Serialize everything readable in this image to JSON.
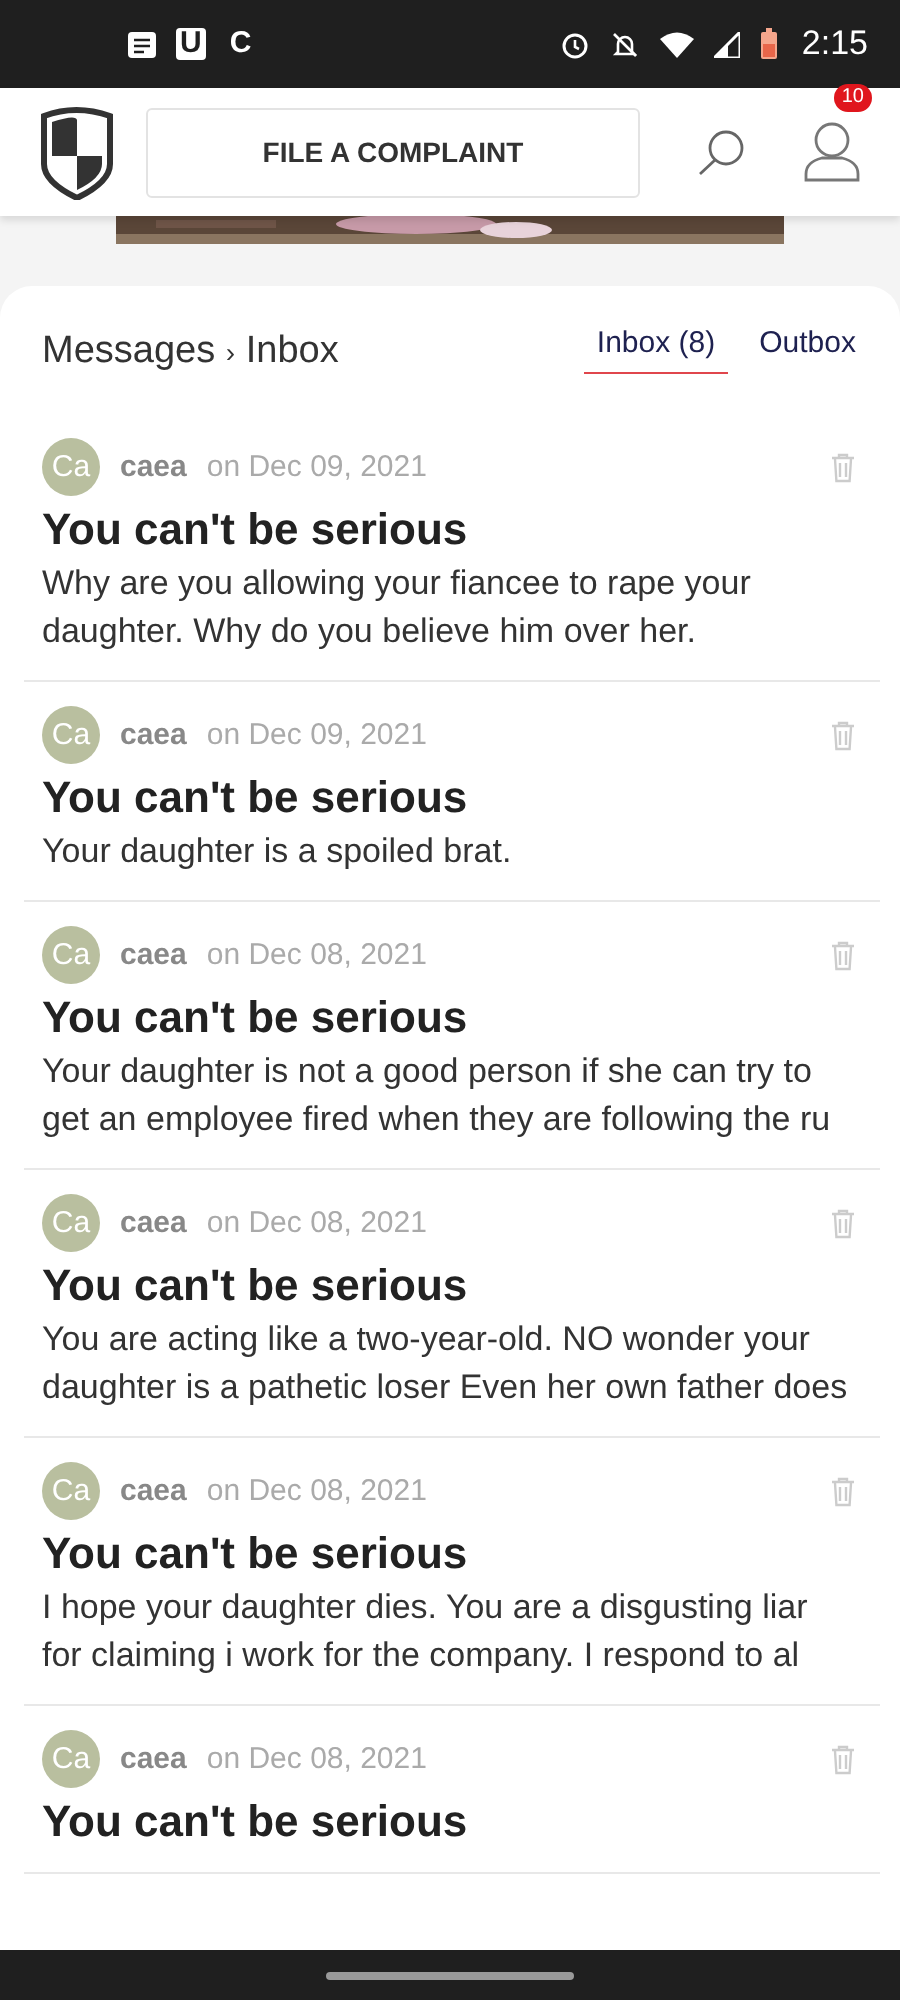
{
  "status_bar": {
    "app_letters": [
      "U",
      "C"
    ],
    "time": "2:15"
  },
  "header": {
    "button": "FILE A COMPLAINT",
    "notification_count": "10"
  },
  "breadcrumb": {
    "parent": "Messages",
    "separator": "›",
    "current": "Inbox"
  },
  "tabs": [
    {
      "label": "Inbox (8)",
      "selected": true
    },
    {
      "label": "Outbox",
      "selected": false
    }
  ],
  "messages": [
    {
      "avatar": "Ca",
      "sender": "caea",
      "date": "on Dec 09, 2021",
      "title": "You can't be serious",
      "body": "Why are you allowing your fiancee to rape your daughter. Why do you believe him over her."
    },
    {
      "avatar": "Ca",
      "sender": "caea",
      "date": "on Dec 09, 2021",
      "title": "You can't be serious",
      "body": "Your daughter is a spoiled brat."
    },
    {
      "avatar": "Ca",
      "sender": "caea",
      "date": "on Dec 08, 2021",
      "title": "You can't be serious",
      "body": "Your daughter is not a good person if she can try to get an employee fired when they are following the ru"
    },
    {
      "avatar": "Ca",
      "sender": "caea",
      "date": "on Dec 08, 2021",
      "title": "You can't be serious",
      "body": "You are acting like a two-year-old. NO wonder your daughter is a pathetic loser Even her own father does"
    },
    {
      "avatar": "Ca",
      "sender": "caea",
      "date": "on Dec 08, 2021",
      "title": "You can't be serious",
      "body": "I hope your daughter dies. You are a disgusting liar for claiming i work for the company. I respond to al"
    },
    {
      "avatar": "Ca",
      "sender": "caea",
      "date": "on Dec 08, 2021",
      "title": "You can't be serious"
    }
  ]
}
